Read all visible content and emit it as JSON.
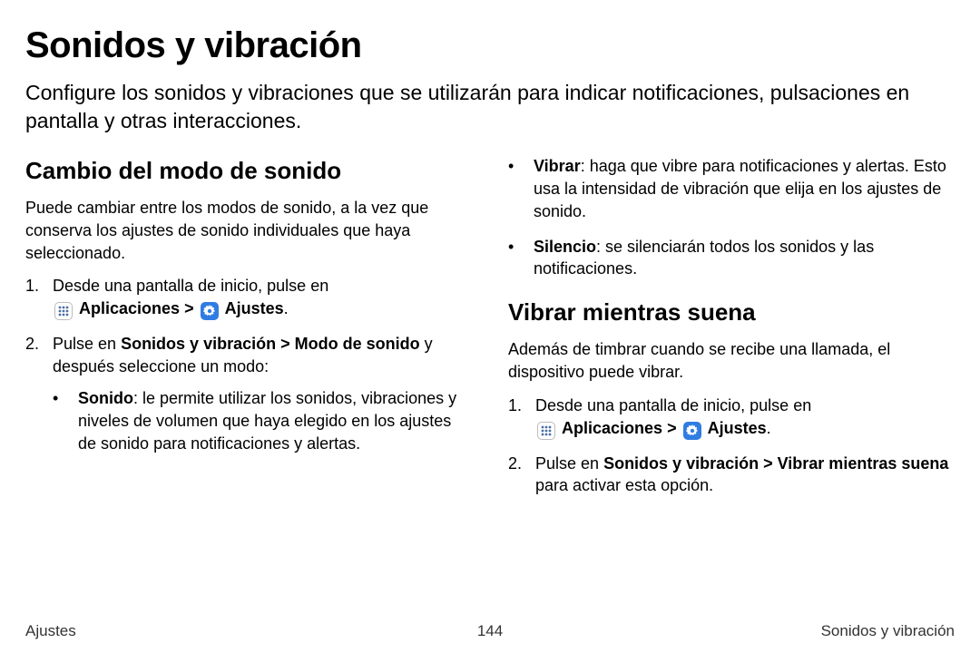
{
  "title": "Sonidos y vibración",
  "intro": "Configure los sonidos y vibraciones que se utilizarán para indicar notificaciones, pulsaciones en pantalla y otras interacciones.",
  "left": {
    "heading": "Cambio del modo de sonido",
    "para": "Puede cambiar entre los modos de sonido, a la vez que conserva los ajustes de sonido individuales que haya seleccionado.",
    "step1_a": "Desde una pantalla de inicio, pulse en ",
    "apps": "Aplicaciones",
    "sep": " > ",
    "settings": "Ajustes",
    "period": ".",
    "step2_a": "Pulse en ",
    "step2_b": "Sonidos y vibración > Modo de sonido",
    "step2_c": " y después seleccione un modo:",
    "mode_sonido_bold": "Sonido",
    "mode_sonido_rest": ": le permite utilizar los sonidos, vibraciones y niveles de volumen que haya elegido en los ajustes de sonido para notificaciones y alertas."
  },
  "right": {
    "mode_vibrar_bold": "Vibrar",
    "mode_vibrar_rest": ": haga que vibre para notificaciones y alertas. Esto usa la intensidad de vibración que elija en los ajustes de sonido.",
    "mode_silencio_bold": "Silencio",
    "mode_silencio_rest": ": se silenciarán todos los sonidos y las notificaciones.",
    "heading": "Vibrar mientras suena",
    "para": "Además de timbrar cuando se recibe una llamada, el dispositivo puede vibrar.",
    "step1_a": "Desde una pantalla de inicio, pulse en ",
    "apps": "Aplicaciones",
    "sep": " > ",
    "settings": "Ajustes",
    "period": ".",
    "step2_a": "Pulse en ",
    "step2_b": "Sonidos y vibración > Vibrar mientras suena",
    "step2_c": " para activar esta opción."
  },
  "footer": {
    "left": "Ajustes",
    "center": "144",
    "right": "Sonidos y vibración"
  }
}
